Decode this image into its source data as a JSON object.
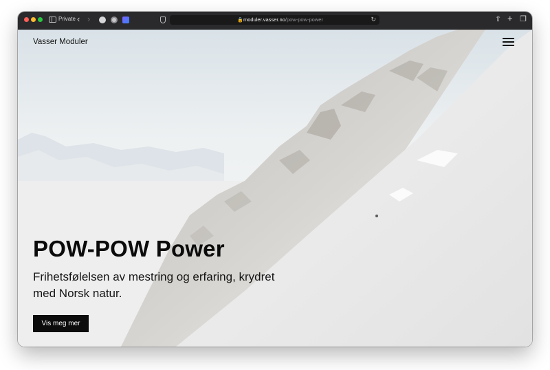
{
  "browser": {
    "mode_label": "Private",
    "url_host": "moduler.vasser.no",
    "url_path": "/pow-pow-power",
    "lock_icon": "lock-icon",
    "icons": [
      "sidebar-toggle-icon",
      "back-icon",
      "forward-icon",
      "shield-icon",
      "reload-icon",
      "share-icon",
      "new-tab-icon",
      "tab-overview-icon"
    ]
  },
  "site": {
    "brand": "Vasser Moduler",
    "menu_icon": "hamburger-menu-icon"
  },
  "hero": {
    "title": "POW-POW Power",
    "subtitle": "Frihetsfølelsen av mestring og erfaring, krydret med Norsk natur.",
    "cta_label": "Vis meg mer"
  },
  "colors": {
    "cta_background": "#0c0c0c",
    "browser_chrome": "#2a2a2c"
  }
}
